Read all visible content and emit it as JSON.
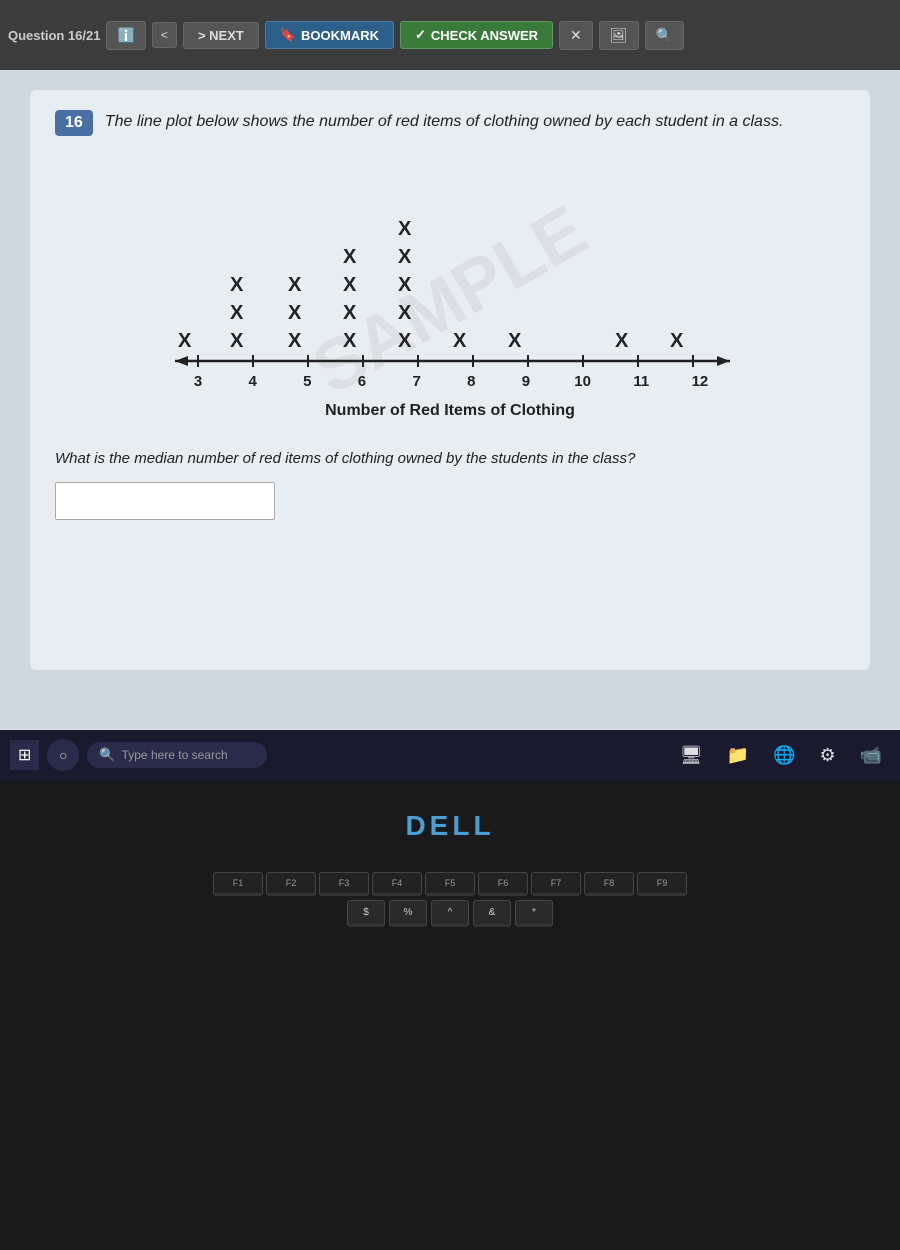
{
  "browser": {
    "question_label": "Question 16/21",
    "nav_back": "<",
    "nav_next": "> NEXT",
    "bookmark_label": "BOOKMARK",
    "check_answer_label": "CHECK ANSWER",
    "close": "✕",
    "icon1": "🖼",
    "icon2": "🔍"
  },
  "question": {
    "number": "16",
    "text": "The line plot below shows the number of red items of clothing owned by each student in a class.",
    "sub_question": "What is the median number of red items of clothing owned by the students in the class?",
    "axis_title": "Number of Red Items of Clothing",
    "axis_labels": [
      "3",
      "4",
      "5",
      "6",
      "7",
      "8",
      "9",
      "10",
      "11",
      "12"
    ],
    "answer_placeholder": ""
  },
  "taskbar": {
    "search_placeholder": "Type here to search",
    "start_icon": "⊞"
  },
  "laptop": {
    "dell_logo": "DELL",
    "fn_keys": [
      "F1",
      "F2",
      "F3",
      "F4",
      "F5",
      "F6",
      "F7",
      "F8",
      "F9"
    ],
    "symbols": [
      "$",
      "%",
      "^",
      "&",
      "*"
    ]
  }
}
